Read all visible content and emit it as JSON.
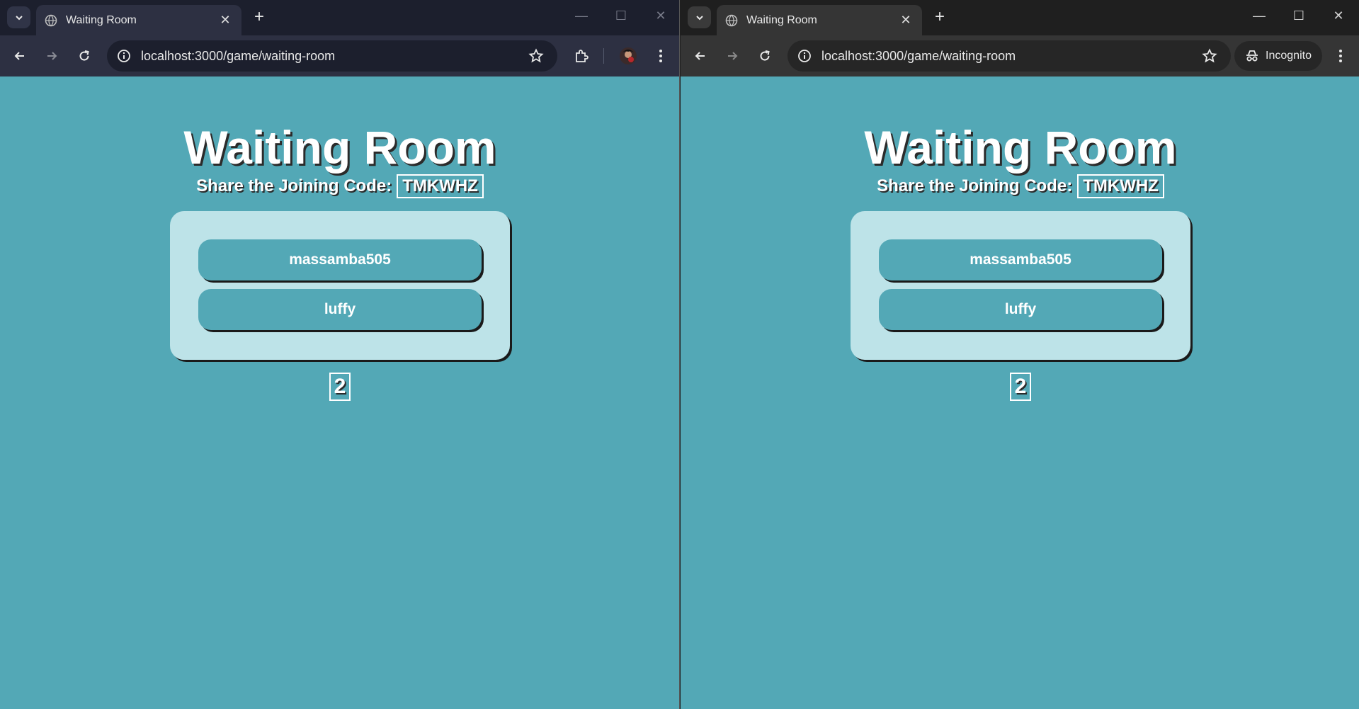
{
  "windows": [
    {
      "tab_title": "Waiting Room",
      "url": "localhost:3000/game/waiting-room",
      "page": {
        "title": "Waiting Room",
        "share_label": "Share the Joining Code:",
        "code": "TMKWHZ",
        "players": [
          "massamba505",
          "luffy"
        ],
        "player_count": "2"
      }
    },
    {
      "tab_title": "Waiting Room",
      "url": "localhost:3000/game/waiting-room",
      "incognito_label": "Incognito",
      "page": {
        "title": "Waiting Room",
        "share_label": "Share the Joining Code:",
        "code": "TMKWHZ",
        "players": [
          "massamba505",
          "luffy"
        ],
        "player_count": "2"
      }
    }
  ],
  "colors": {
    "page_bg": "#53a8b6",
    "panel_bg": "#bde3e8",
    "player_bg": "#53a8b6"
  }
}
